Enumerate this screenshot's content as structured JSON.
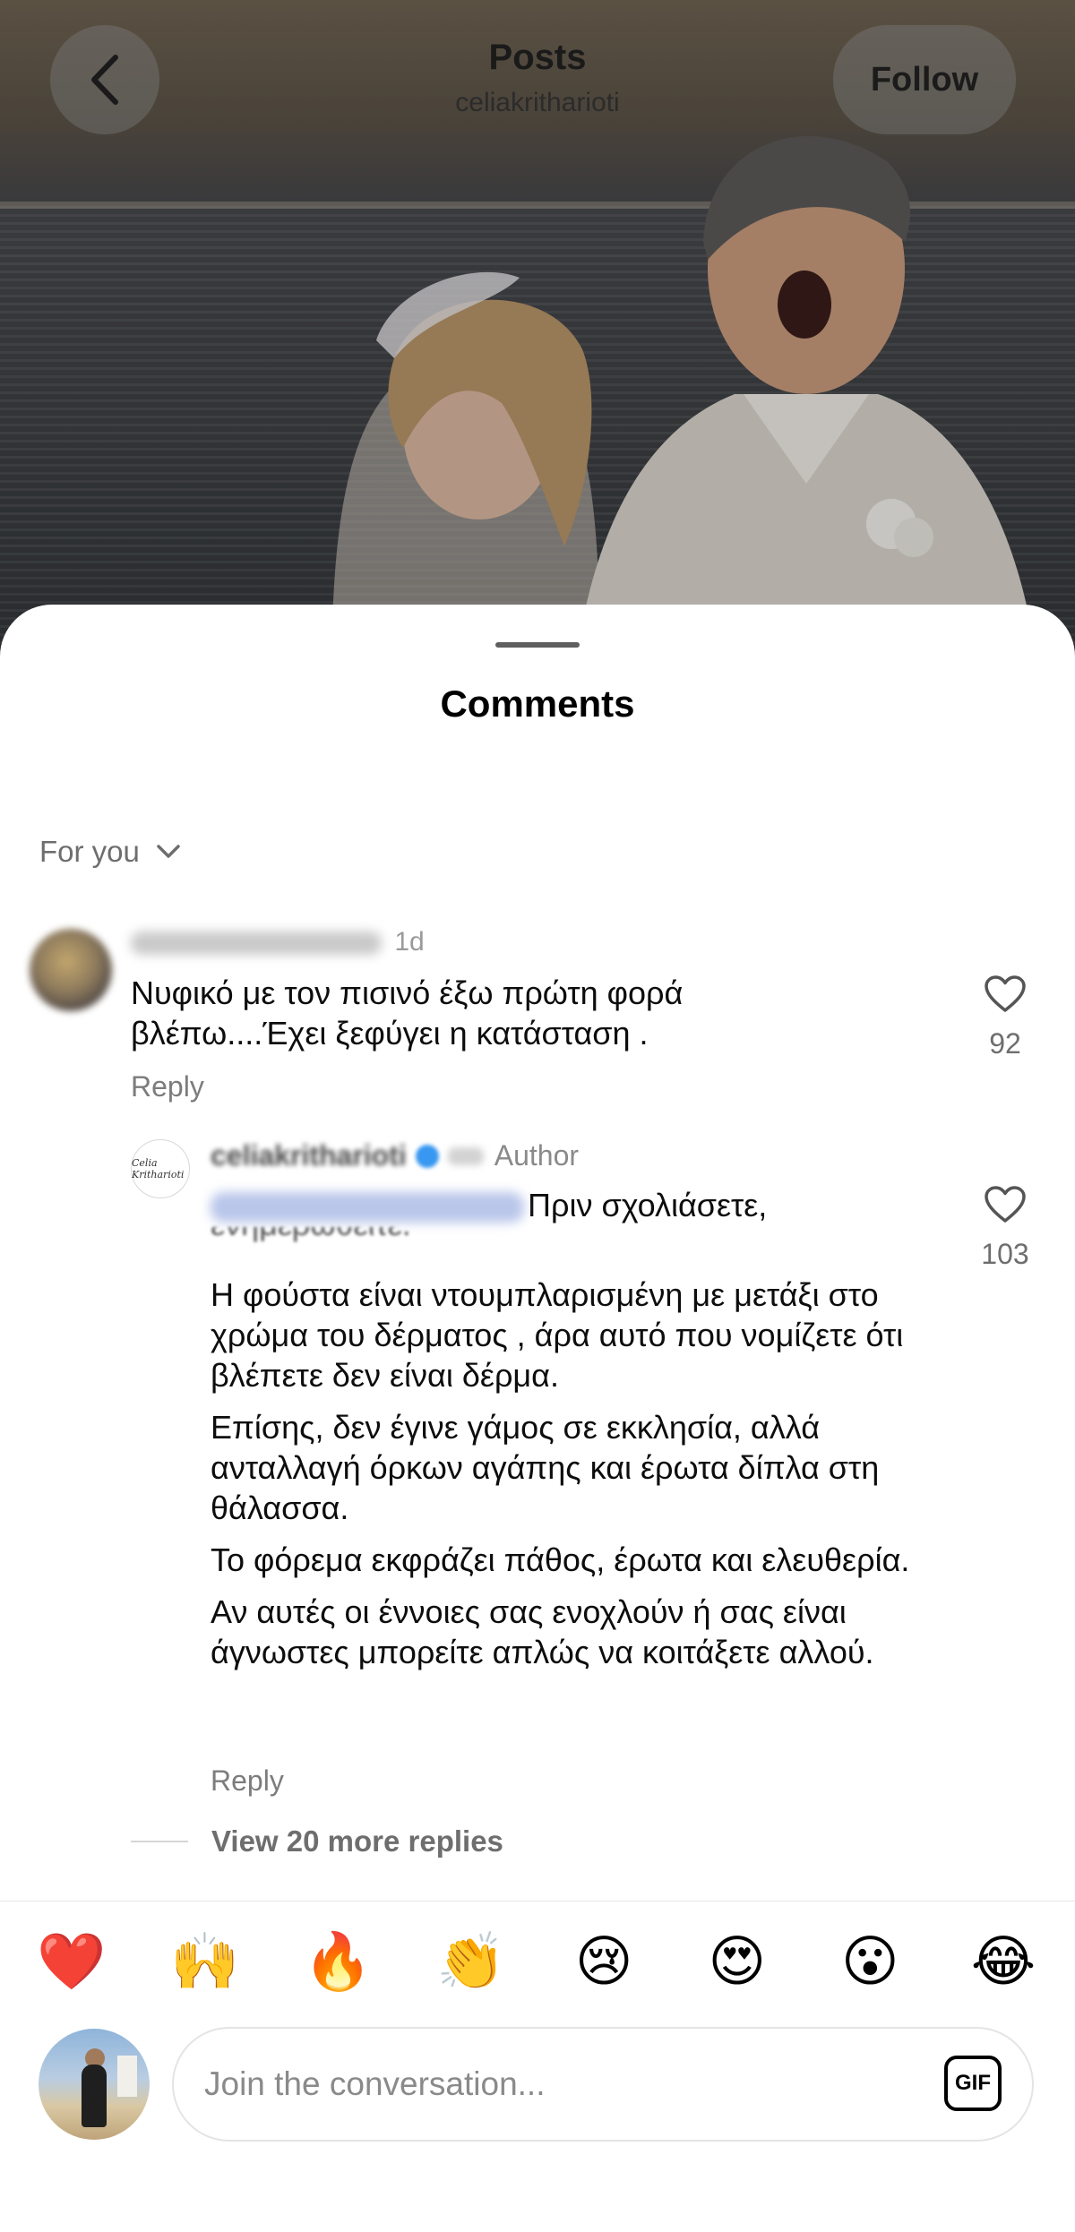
{
  "header": {
    "title": "Posts",
    "username": "celiakritharioti",
    "follow_label": "Follow"
  },
  "sheet": {
    "title": "Comments",
    "sort_label": "For you"
  },
  "comments": [
    {
      "age": "1d",
      "text": "Νυφικό με τον πισινό έξω πρώτη φορά βλέπω....Έχει ξεφύγει η κατάσταση .",
      "reply_label": "Reply",
      "likes": "92"
    },
    {
      "username": "celiakritharioti",
      "badge": "Author",
      "avatar_text": "Celia Kritharioti",
      "mention_tail": "Πριν σχολιάσετε,",
      "cut_line": "ενημερωθείτε.",
      "paragraphs": [
        "Η φούστα είναι ντουμπλαρισμένη με μετάξι στο χρώμα του δέρματος , άρα αυτό που νομίζετε ότι βλέπετε δεν είναι δέρμα.",
        "Επίσης, δεν έγινε γάμος σε εκκλησία, αλλά ανταλλαγή όρκων αγάπης και έρωτα δίπλα στη θάλασσα.",
        "Το φόρεμα εκφράζει πάθος, έρωτα και ελευθερία.",
        "Αν αυτές οι έννοιες σας ενοχλούν ή σας είναι άγνωστες μπορείτε απλώς να κοιτάξετε αλλού."
      ],
      "reply_label": "Reply",
      "likes": "103"
    }
  ],
  "more_replies_label": "View 20 more replies",
  "emojis": [
    "❤️",
    "🙌",
    "🔥",
    "👏",
    "😢",
    "😍",
    "😮",
    "😂"
  ],
  "composer": {
    "placeholder": "Join the conversation...",
    "gif_label": "GIF"
  },
  "colors": {
    "like_outline": "#555555",
    "verified": "#3897f0",
    "muted_text": "#6e6e6e"
  }
}
